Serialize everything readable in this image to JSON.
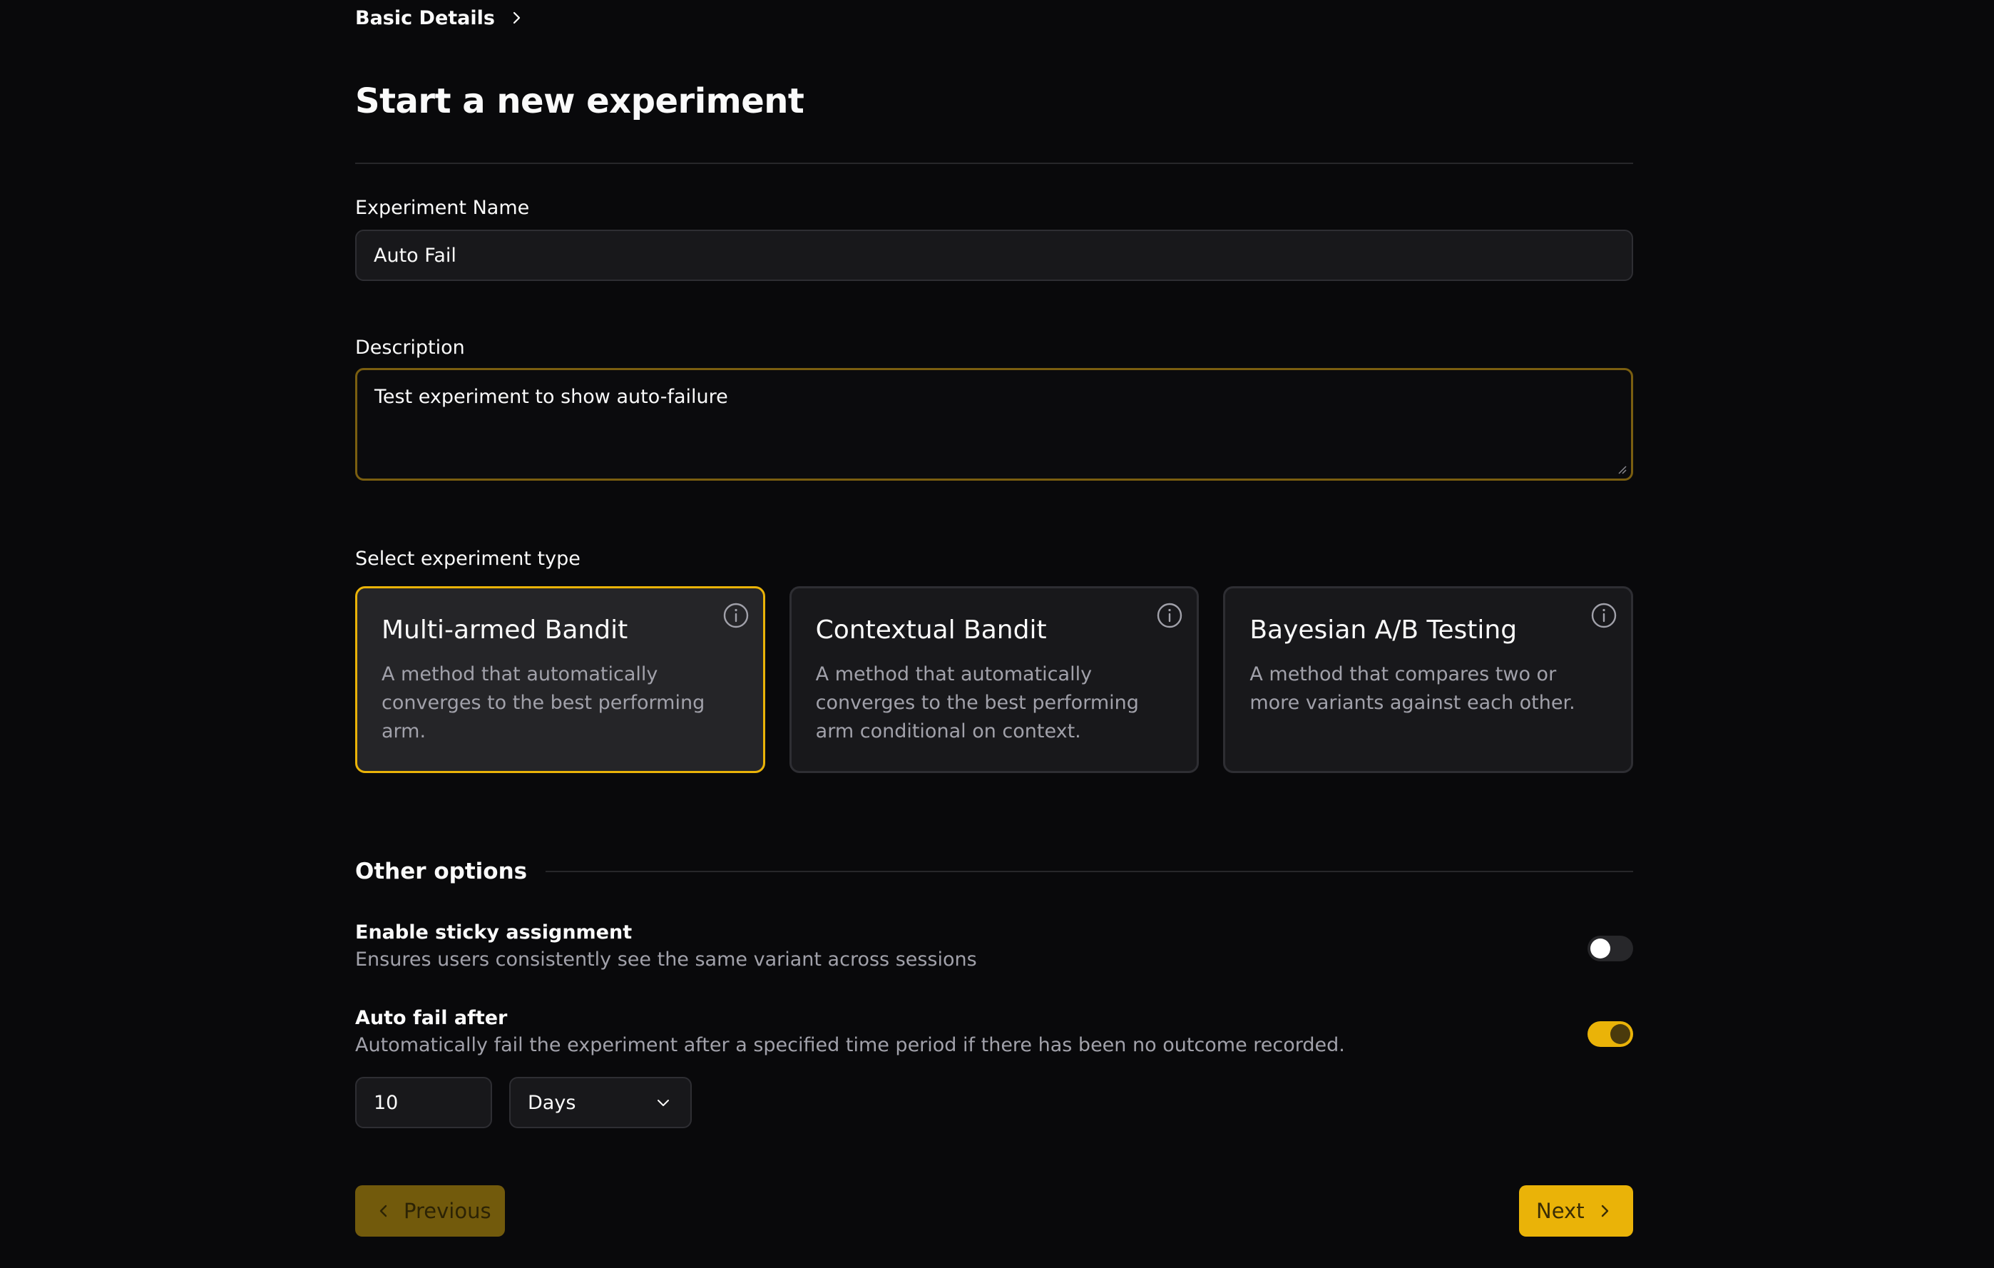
{
  "breadcrumb": {
    "label": "Basic Details",
    "icon": "chevron-right-icon"
  },
  "page": {
    "title": "Start a new experiment"
  },
  "form": {
    "name_label": "Experiment Name",
    "name_value": "Auto Fail",
    "description_label": "Description",
    "description_value": "Test experiment to show auto-failure",
    "type_label": "Select experiment type"
  },
  "experiment_types": [
    {
      "title": "Multi-armed Bandit",
      "description": "A method that automatically converges to the best performing arm.",
      "selected": true,
      "icon": "info-icon"
    },
    {
      "title": "Contextual Bandit",
      "description": "A method that automatically converges to the best performing arm conditional on context.",
      "selected": false,
      "icon": "info-icon"
    },
    {
      "title": "Bayesian A/B Testing",
      "description": "A method that compares two or more variants against each other.",
      "selected": false,
      "icon": "info-icon"
    }
  ],
  "other_options": {
    "title": "Other options",
    "sticky": {
      "title": "Enable sticky assignment",
      "description": "Ensures users consistently see the same variant across sessions",
      "enabled": false
    },
    "auto_fail": {
      "title": "Auto fail after",
      "description": "Automatically fail the experiment after a specified time period if there has been no outcome recorded.",
      "enabled": true,
      "value": "10",
      "unit": "Days"
    }
  },
  "nav": {
    "previous_label": "Previous",
    "next_label": "Next"
  },
  "colors": {
    "accent": "#eab308",
    "background": "#09090b",
    "card": "#18181b",
    "muted_text": "#a1a1aa"
  }
}
